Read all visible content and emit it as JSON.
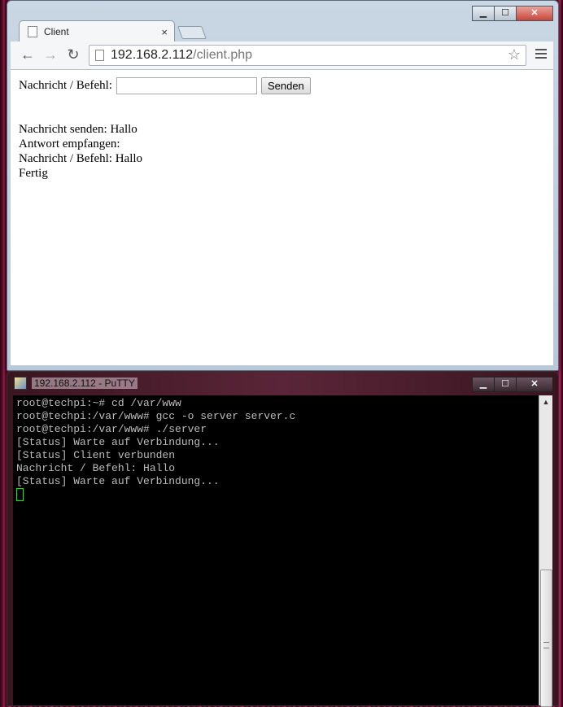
{
  "browser": {
    "tab_title": "Client",
    "tab_close": "×",
    "url_host": "192.168.2.112",
    "url_path": "/client.php",
    "icons": [
      "back-arrow-icon",
      "forward-arrow-icon",
      "reload-icon",
      "page-icon",
      "star-icon",
      "menu-icon"
    ]
  },
  "page": {
    "form_label": "Nachricht / Befehl:",
    "input_value": "",
    "submit_label": "Senden",
    "output_lines": [
      "Nachricht senden: Hallo",
      "Antwort empfangen:",
      "Nachricht / Befehl: Hallo",
      "Fertig"
    ]
  },
  "putty": {
    "title": "192.168.2.112 - PuTTY",
    "lines": [
      "root@techpi:~# cd /var/www",
      "root@techpi:/var/www# gcc -o server server.c",
      "root@techpi:/var/www# ./server",
      "[Status] Warte auf Verbindung...",
      "[Status] Client verbunden",
      "Nachricht / Befehl: Hallo",
      "[Status] Warte auf Verbindung..."
    ]
  },
  "window_controls": {
    "minimize": "▁",
    "maximize": "☐",
    "close": "✕"
  }
}
